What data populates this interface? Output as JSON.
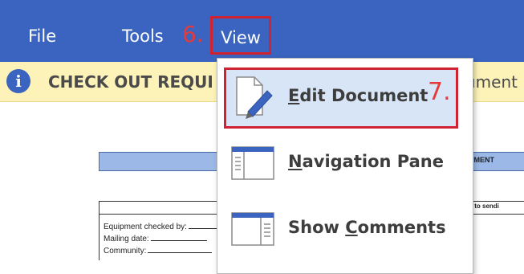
{
  "menubar": {
    "file_label": "File",
    "tools_label": "Tools",
    "view_label": "View",
    "step_6": "6."
  },
  "infobar": {
    "icon_glyph": "i",
    "text": "CHECK OUT REQUI",
    "text_right": "ument"
  },
  "document": {
    "band_text": "IPMENT",
    "right_text": "or to sendi",
    "fields": [
      "Equipment checked by:",
      "Mailing date:",
      "Community:"
    ]
  },
  "view_menu": {
    "items": [
      {
        "label": "Edit Document",
        "mnemonic": "E",
        "rest": "dit Document",
        "icon": "edit-document-icon"
      },
      {
        "label": "Navigation Pane",
        "mnemonic": "N",
        "rest": "avigation Pane",
        "icon": "navigation-pane-icon"
      },
      {
        "label": "Show Comments",
        "pre": "Show ",
        "mnemonic": "C",
        "rest": "omments",
        "icon": "comments-pane-icon"
      }
    ],
    "step_7": "7."
  },
  "colors": {
    "menubar_bg": "#3a64bf",
    "infobar_bg": "#fdf3b8",
    "highlight_bg": "#d7e5f6",
    "annotation_red": "#e53a3a",
    "box_red": "#cf2233"
  }
}
